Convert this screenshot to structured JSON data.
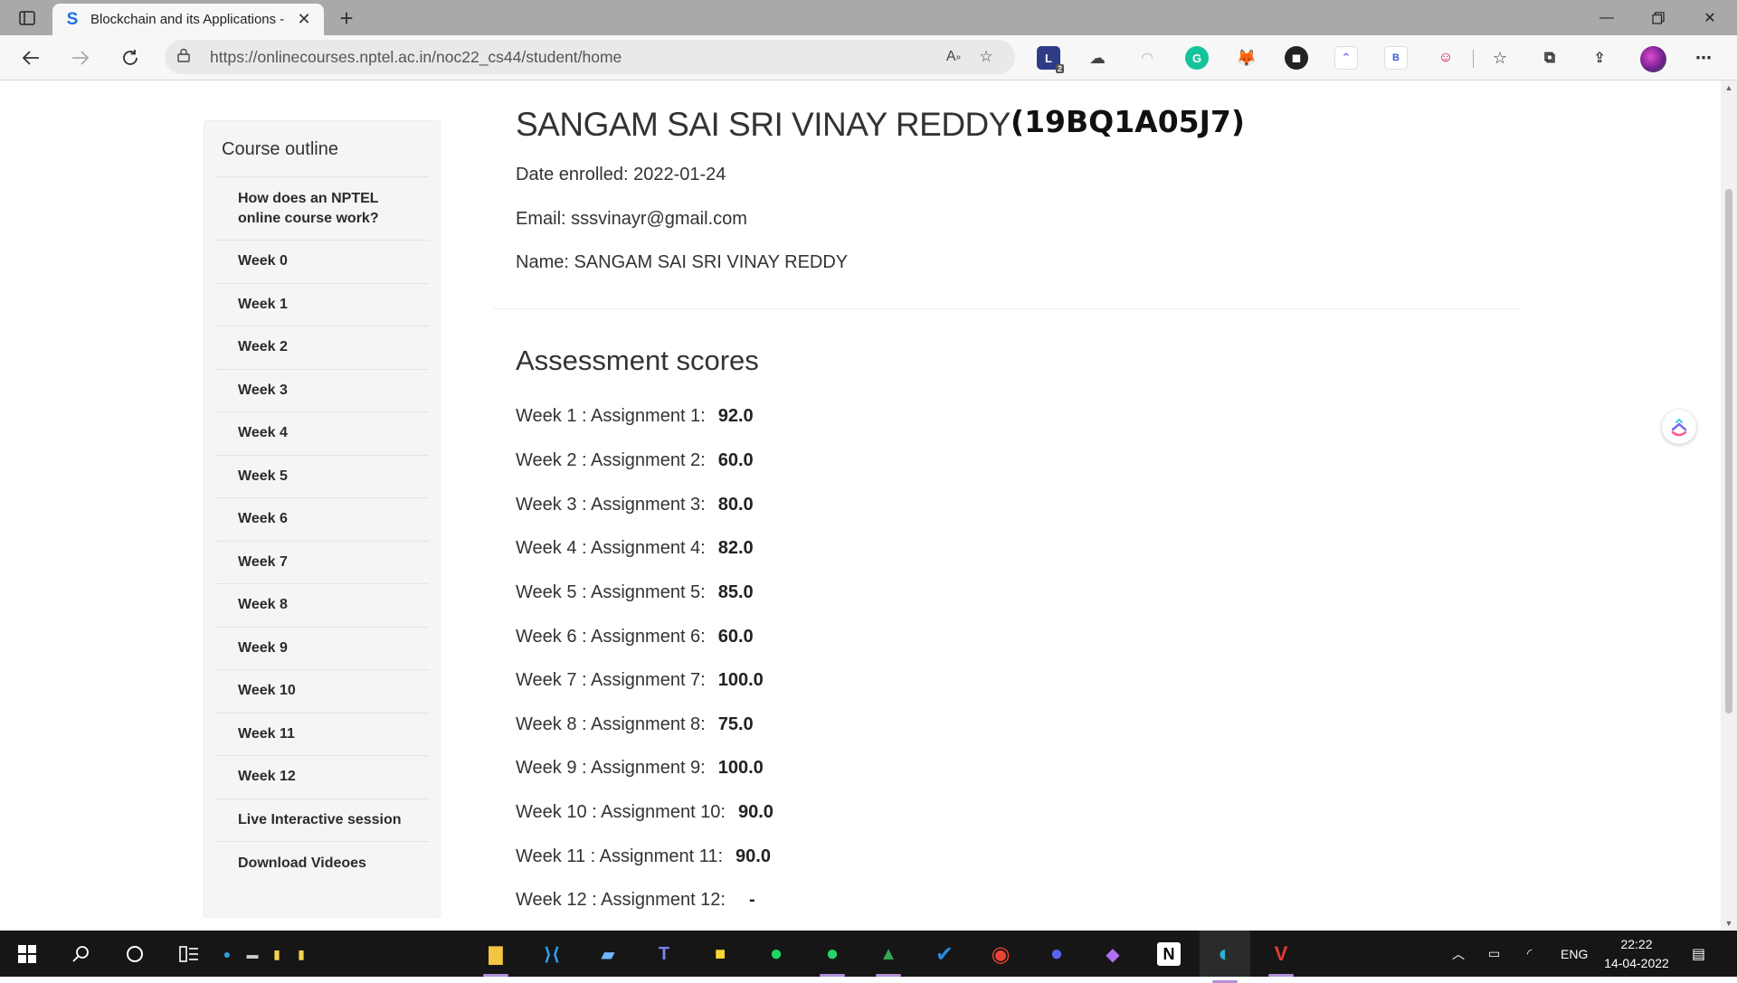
{
  "browser": {
    "tab_title": "Blockchain and its Applications - ",
    "url": "https://onlinecourses.nptel.ac.in/noc22_cs44/student/home",
    "extension_badge": "2"
  },
  "sidebar": {
    "title": "Course outline",
    "items": [
      {
        "label": "How does an NPTEL online course work?"
      },
      {
        "label": "Week 0"
      },
      {
        "label": "Week 1"
      },
      {
        "label": "Week 2"
      },
      {
        "label": "Week 3"
      },
      {
        "label": "Week 4"
      },
      {
        "label": "Week 5"
      },
      {
        "label": "Week 6"
      },
      {
        "label": "Week 7"
      },
      {
        "label": "Week 8"
      },
      {
        "label": "Week 9"
      },
      {
        "label": "Week 10"
      },
      {
        "label": "Week 11"
      },
      {
        "label": "Week 12"
      },
      {
        "label": "Live Interactive session"
      },
      {
        "label": "Download Videoes"
      }
    ]
  },
  "student": {
    "name_heading": "SANGAM SAI SRI VINAY REDDY",
    "roll_number": "(19BQ1A05J7)",
    "date_enrolled": "Date enrolled: 2022-01-24",
    "email": "Email: sssvinayr@gmail.com",
    "name_line": "Name: SANGAM SAI SRI VINAY REDDY"
  },
  "assessment": {
    "title": "Assessment scores",
    "scores": [
      {
        "label": "Week 1 : Assignment 1:",
        "value": "92.0"
      },
      {
        "label": "Week 2 : Assignment 2:",
        "value": "60.0"
      },
      {
        "label": "Week 3 : Assignment 3:",
        "value": "80.0"
      },
      {
        "label": "Week 4 : Assignment 4:",
        "value": "82.0"
      },
      {
        "label": "Week 5 : Assignment 5:",
        "value": "85.0"
      },
      {
        "label": "Week 6 : Assignment 6:",
        "value": "60.0"
      },
      {
        "label": "Week 7 : Assignment 7:",
        "value": "100.0"
      },
      {
        "label": "Week 8 : Assignment 8:",
        "value": "75.0"
      },
      {
        "label": "Week 9 : Assignment 9:",
        "value": "100.0"
      },
      {
        "label": "Week 10 : Assignment 10:",
        "value": "90.0"
      },
      {
        "label": "Week 11 : Assignment 11:",
        "value": "90.0"
      },
      {
        "label": "Week 12 : Assignment 12:",
        "value": "-"
      }
    ]
  },
  "taskbar": {
    "language": "ENG",
    "time": "22:22",
    "date": "14-04-2022"
  },
  "colors": {
    "tabbar_bg": "#a9a9a9",
    "toolbar_bg": "#f7f7f7",
    "sidebar_bg": "#f5f5f5",
    "taskbar_bg": "#161616"
  },
  "icons": [
    "tab-actions-icon",
    "s-favicon-icon",
    "close-icon",
    "plus-icon",
    "minimize-icon",
    "restore-icon",
    "back-icon",
    "forward-icon",
    "refresh-icon",
    "lock-icon",
    "read-aloud-icon",
    "add-favorite-icon",
    "favorites-icon",
    "collections-icon",
    "share-icon",
    "more-icon",
    "windows-start-icon",
    "search-icon",
    "cortana-icon",
    "task-view-icon"
  ]
}
